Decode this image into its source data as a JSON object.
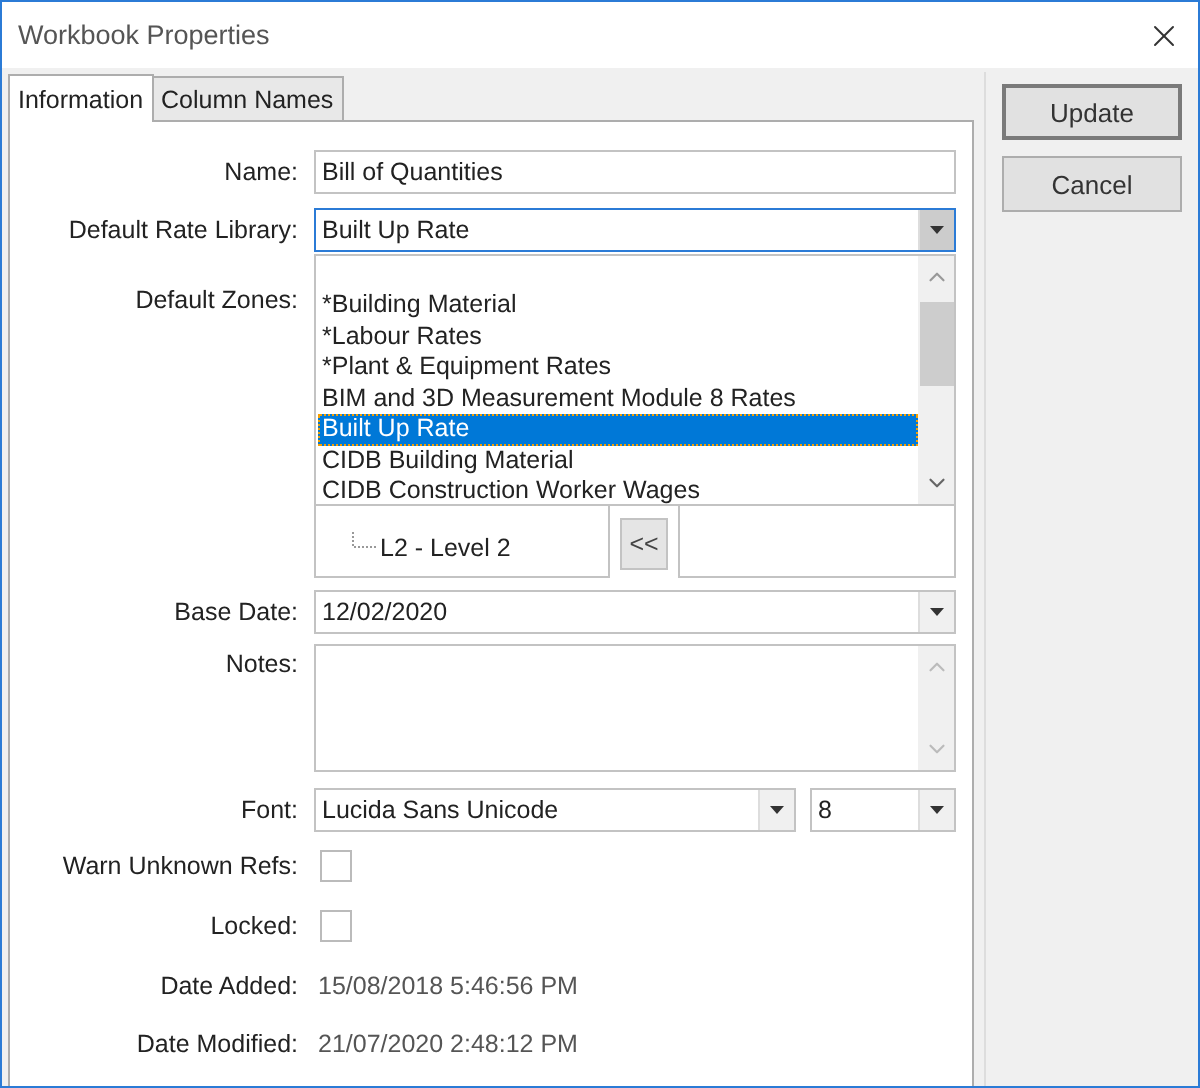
{
  "window": {
    "title": "Workbook Properties"
  },
  "tabs": [
    {
      "label": "Information",
      "selected": true
    },
    {
      "label": "Column Names",
      "selected": false
    }
  ],
  "form": [
    {
      "kind": "text",
      "label": "Name:",
      "value": "Bill of Quantities"
    },
    {
      "kind": "combo",
      "label": "Default Rate Library:",
      "value": "Built Up Rate",
      "expanded": true,
      "options": [
        {
          "label": "*Building Material",
          "selected": false
        },
        {
          "label": "*Labour Rates",
          "selected": false
        },
        {
          "label": "*Plant & Equipment Rates",
          "selected": false
        },
        {
          "label": "BIM and 3D Measurement Module 8 Rates",
          "selected": false
        },
        {
          "label": "Built Up Rate",
          "selected": true
        },
        {
          "label": "CIDB Building Material",
          "selected": false
        },
        {
          "label": "CIDB Construction Worker Wages",
          "selected": false
        }
      ]
    },
    {
      "kind": "zones",
      "label": "Default Zones:",
      "tree": [
        {
          "label": "L2 - Level 2"
        }
      ],
      "move_button": "<<"
    },
    {
      "kind": "date",
      "label": "Base Date:",
      "value": "12/02/2020"
    },
    {
      "kind": "notes",
      "label": "Notes:"
    },
    {
      "kind": "font",
      "label": "Font:",
      "value": "Lucida Sans Unicode",
      "size": "8"
    },
    {
      "kind": "checkbox",
      "label": "Warn Unknown Refs:",
      "checked": false
    },
    {
      "kind": "checkbox",
      "label": "Locked:",
      "checked": false
    },
    {
      "kind": "info",
      "label": "Date Added:",
      "value": "15/08/2018 5:46:56 PM"
    },
    {
      "kind": "info",
      "label": "Date Modified:",
      "value": "21/07/2020 2:48:12 PM"
    }
  ],
  "buttons": [
    {
      "label": "Update",
      "default": true
    },
    {
      "label": "Cancel",
      "default": false
    }
  ]
}
